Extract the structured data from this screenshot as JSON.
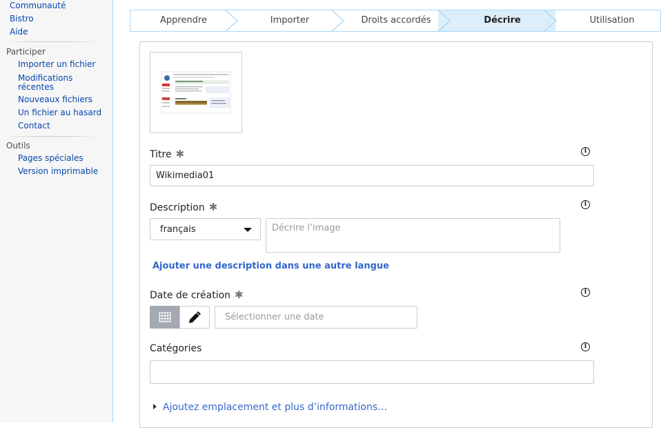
{
  "sidebar": {
    "top_links": [
      "Communauté",
      "Bistro",
      "Aide"
    ],
    "participer": {
      "heading": "Participer",
      "items": [
        "Importer un fichier",
        "Modifications\nrécentes",
        "Nouveaux fichiers",
        "Un fichier au hasard",
        "Contact"
      ]
    },
    "outils": {
      "heading": "Outils",
      "items": [
        "Pages spéciales",
        "Version imprimable"
      ]
    }
  },
  "steps": {
    "items": [
      "Apprendre",
      "Importer",
      "Droits accordés",
      "Décrire",
      "Utilisation"
    ],
    "active_index": 3,
    "active_bg": "#ddeefb",
    "border_color": "#a7d7f9"
  },
  "form": {
    "title": {
      "label": "Titre",
      "required_mark": "✱",
      "value": "Wikimedia01"
    },
    "description": {
      "label": "Description",
      "required_mark": "✱",
      "language": "français",
      "placeholder": "Décrire l’image",
      "add_language_link": "Ajouter une description dans une autre langue"
    },
    "date": {
      "label": "Date de création",
      "required_mark": "✱",
      "placeholder": "Sélectionner une date",
      "calendar_icon": "calendar-grid-icon",
      "edit_icon": "pencil-icon"
    },
    "categories": {
      "label": "Catégories",
      "value": ""
    },
    "more_info_link": "Ajoutez emplacement et plus d’informations…",
    "info_icon": "info-icon"
  },
  "colors": {
    "link": "#0645ad",
    "accent_link": "#3366cc",
    "field_border": "#c8ccd1"
  }
}
